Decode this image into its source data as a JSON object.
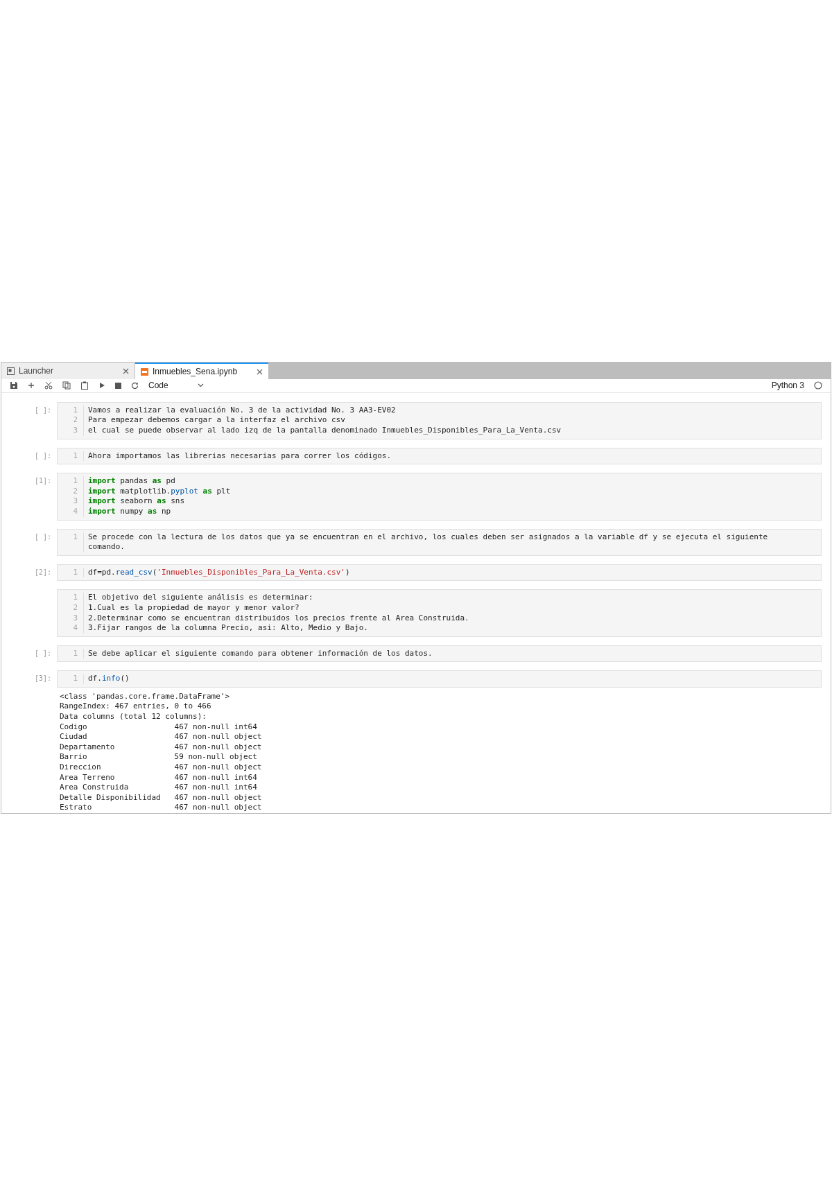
{
  "tabs": [
    {
      "label": "Launcher",
      "selected": false,
      "kind": "launcher"
    },
    {
      "label": "Inmuebles_Sena.ipynb",
      "selected": true,
      "kind": "notebook"
    }
  ],
  "toolbar": {
    "cell_type": "Code",
    "kernel": "Python 3"
  },
  "cells": [
    {
      "prompt": "[ ]:",
      "lines": [
        {
          "number": "1",
          "tokens": [
            {
              "text": "Vamos a realizar la evaluación No. 3 de la actividad No. 3 AA3-EV02",
              "kind": "plain"
            }
          ]
        },
        {
          "number": "2",
          "tokens": [
            {
              "text": "Para empezar debemos cargar a la interfaz el archivo csv",
              "kind": "plain"
            }
          ]
        },
        {
          "number": "3",
          "tokens": [
            {
              "text": "el cual se puede observar al lado izq de la pantalla denominado Inmuebles_Disponibles_Para_La_Venta.csv",
              "kind": "plain"
            }
          ]
        }
      ]
    },
    {
      "prompt": "[ ]:",
      "lines": [
        {
          "number": "1",
          "tokens": [
            {
              "text": "Ahora importamos las librerias necesarias para correr los códigos.",
              "kind": "plain"
            }
          ]
        }
      ]
    },
    {
      "prompt": "[1]:",
      "lines": [
        {
          "number": "1",
          "tokens": [
            {
              "text": "import",
              "kind": "keyword"
            },
            {
              "text": " pandas ",
              "kind": "plain"
            },
            {
              "text": "as",
              "kind": "keyword"
            },
            {
              "text": " pd",
              "kind": "plain"
            }
          ]
        },
        {
          "number": "2",
          "tokens": [
            {
              "text": "import",
              "kind": "keyword"
            },
            {
              "text": " matplotlib.",
              "kind": "plain"
            },
            {
              "text": "pyplot",
              "kind": "attribute"
            },
            {
              "text": " as",
              "kind": "keyword"
            },
            {
              "text": " plt",
              "kind": "plain"
            }
          ]
        },
        {
          "number": "3",
          "tokens": [
            {
              "text": "import",
              "kind": "keyword"
            },
            {
              "text": " seaborn ",
              "kind": "plain"
            },
            {
              "text": "as",
              "kind": "keyword"
            },
            {
              "text": " sns",
              "kind": "plain"
            }
          ]
        },
        {
          "number": "4",
          "tokens": [
            {
              "text": "import",
              "kind": "keyword"
            },
            {
              "text": " numpy ",
              "kind": "plain"
            },
            {
              "text": "as",
              "kind": "keyword"
            },
            {
              "text": " np",
              "kind": "plain"
            }
          ]
        }
      ]
    },
    {
      "prompt": "[ ]:",
      "lines": [
        {
          "number": "1",
          "tokens": [
            {
              "text": "Se procede con la lectura de los datos que ya se encuentran en el archivo, los cuales deben ser asignados a la variable df y se ejecuta el siguiente comando.",
              "kind": "plain"
            }
          ]
        }
      ]
    },
    {
      "prompt": "[2]:",
      "lines": [
        {
          "number": "1",
          "tokens": [
            {
              "text": "df=pd.",
              "kind": "plain"
            },
            {
              "text": "read_csv",
              "kind": "attribute"
            },
            {
              "text": "(",
              "kind": "plain"
            },
            {
              "text": "'Inmuebles_Disponibles_Para_La_Venta.csv'",
              "kind": "string"
            },
            {
              "text": ")",
              "kind": "plain"
            }
          ]
        }
      ]
    },
    {
      "lines": [
        {
          "number": "1",
          "tokens": [
            {
              "text": "El objetivo del siguiente análisis es determinar:",
              "kind": "plain"
            }
          ]
        },
        {
          "number": "2",
          "tokens": [
            {
              "text": "1.Cual es la propiedad de mayor y menor valor?",
              "kind": "plain"
            }
          ]
        },
        {
          "number": "3",
          "tokens": [
            {
              "text": "2.Determinar como se encuentran distribuidos los precios frente al Area Construida.",
              "kind": "plain"
            }
          ]
        },
        {
          "number": "4",
          "tokens": [
            {
              "text": "3.Fijar rangos de la columna Precio, asi: Alto, Medio y Bajo.",
              "kind": "plain"
            }
          ]
        }
      ]
    },
    {
      "prompt": "[ ]:",
      "lines": [
        {
          "number": "1",
          "tokens": [
            {
              "text": "Se debe aplicar el siguiente comando para obtener información de los datos.",
              "kind": "plain"
            }
          ]
        }
      ]
    },
    {
      "prompt": "[3]:",
      "lines": [
        {
          "number": "1",
          "tokens": [
            {
              "text": "df.",
              "kind": "plain"
            },
            {
              "text": "info",
              "kind": "attribute"
            },
            {
              "text": "()",
              "kind": "plain"
            }
          ]
        }
      ],
      "output": [
        "<class 'pandas.core.frame.DataFrame'>",
        "RangeIndex: 467 entries, 0 to 466",
        "Data columns (total 12 columns):",
        "Codigo                   467 non-null int64",
        "Ciudad                   467 non-null object",
        "Departamento             467 non-null object",
        "Barrio                   59 non-null object",
        "Direccion                467 non-null object",
        "Area Terreno             467 non-null int64",
        "Area Construida          467 non-null int64",
        "Detalle Disponibilidad   467 non-null object",
        "Estrato                  467 non-null object"
      ]
    }
  ]
}
